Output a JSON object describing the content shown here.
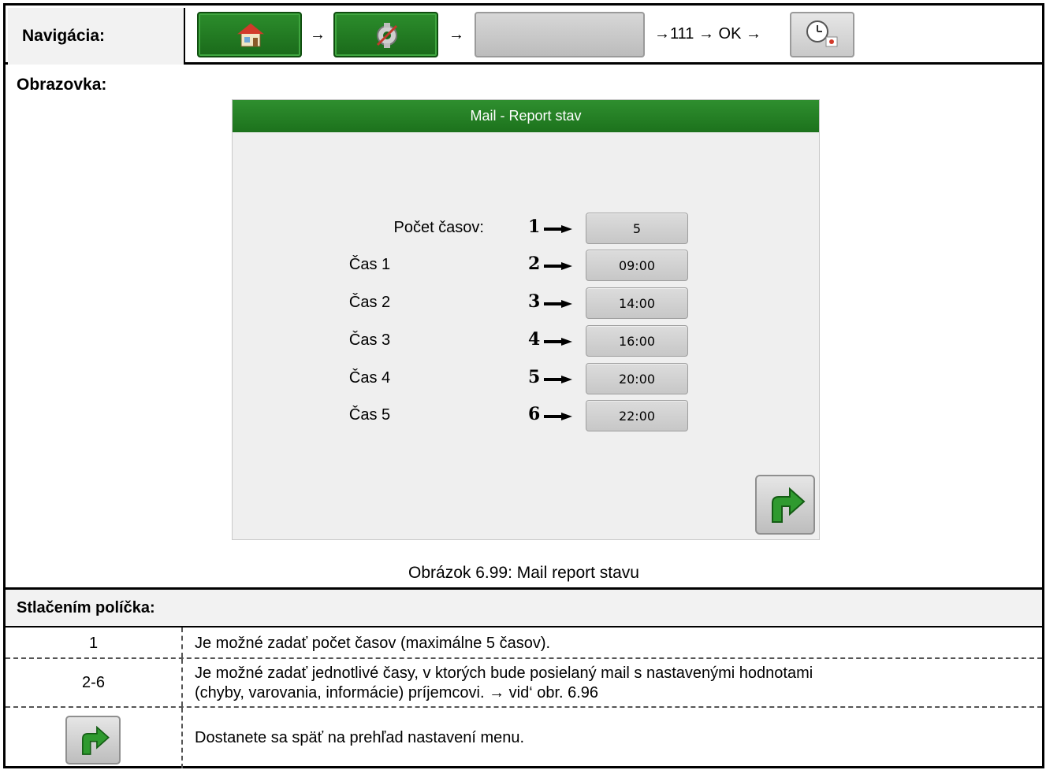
{
  "navigation": {
    "label": "Navigácia:",
    "arrow": "→",
    "tail_text": "→111 → OK →",
    "icons": [
      "home-icon",
      "settings-icon",
      "blank-button",
      "clock-report-icon"
    ]
  },
  "screen": {
    "label": "Obrazovka:",
    "device_title": "Mail - Report stav",
    "rows": [
      {
        "label": "Počet časov:",
        "num": "1",
        "value": "5"
      },
      {
        "label": "Čas 1",
        "num": "2",
        "value": "09:00"
      },
      {
        "label": "Čas 2",
        "num": "3",
        "value": "14:00"
      },
      {
        "label": "Čas 3",
        "num": "4",
        "value": "16:00"
      },
      {
        "label": "Čas 4",
        "num": "5",
        "value": "20:00"
      },
      {
        "label": "Čas 5",
        "num": "6",
        "value": "22:00"
      }
    ],
    "caption": "Obrázok 6.99: Mail report  stavu"
  },
  "press": {
    "label": "Stlačením políčka:",
    "rows": [
      {
        "key": "1",
        "text": "Je možné zadať počet časov  (maximálne 5 časov)."
      },
      {
        "key": "2-6",
        "text_line1": "Je možné zadať jednotlivé časy, v ktorých bude posielaný mail s nastavenými hodnotami",
        "text_line2": "(chyby, varovania, informácie) príjemcovi. → vid‘ obr. 6.96"
      },
      {
        "key_icon": "back-arrow-icon",
        "text": "Dostanete sa späť na prehľad nastavení menu."
      }
    ]
  },
  "colors": {
    "header_green": "#1c721c",
    "label_bg": "#f2f2f2",
    "field_gray": "#c7c7c7"
  }
}
